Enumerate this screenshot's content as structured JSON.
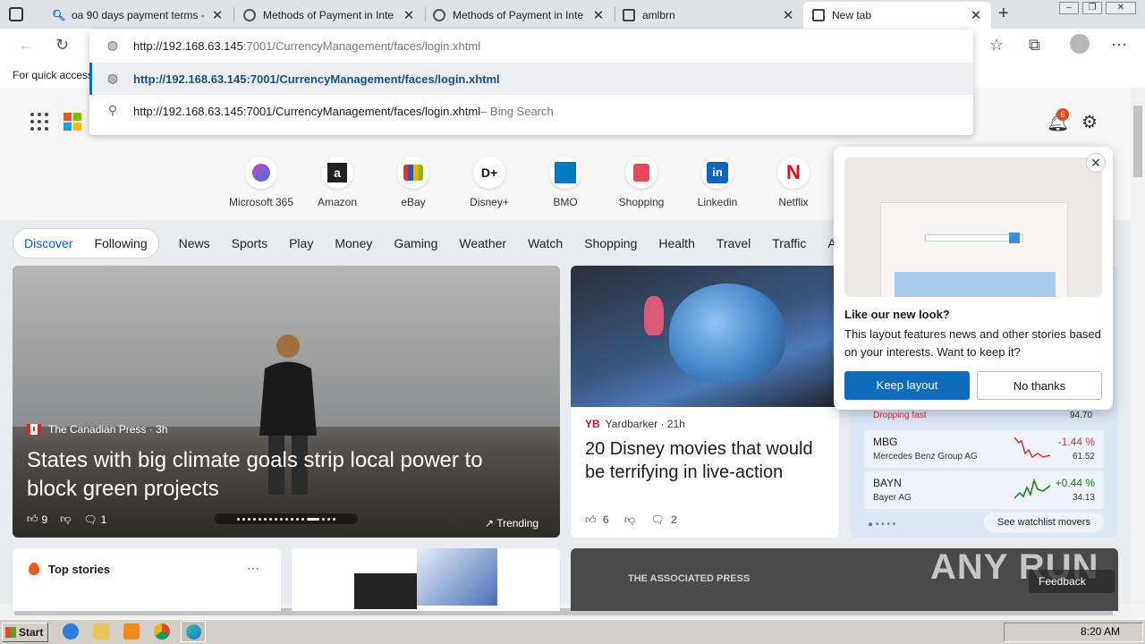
{
  "browser": {
    "tabs": [
      {
        "title": "oa 90 days payment terms -"
      },
      {
        "title": "Methods of Payment in Inte"
      },
      {
        "title": "Methods of Payment in Inte"
      },
      {
        "title": "amlbrn"
      },
      {
        "title": "New tab"
      }
    ],
    "address_bar": {
      "url_host": "http://192.168.63.145",
      "url_rest": ":7001/CurrencyManagement/faces/login.xhtml",
      "suggestion_url": "http://192.168.63.145:7001/CurrencyManagement/faces/login.xhtml",
      "search_text": "http://192.168.63.145:7001/CurrencyManagement/faces/login.xhtml",
      "search_suffix": " – Bing Search"
    },
    "bookmarks_bar_text": "For quick access"
  },
  "header": {
    "notification_count": "6"
  },
  "quick_links": [
    {
      "label": "Microsoft 365",
      "icon": "ms365-icon"
    },
    {
      "label": "Amazon",
      "icon": "amazon-icon"
    },
    {
      "label": "eBay",
      "icon": "ebay-icon"
    },
    {
      "label": "Disney+",
      "icon": "disney-icon"
    },
    {
      "label": "BMO",
      "icon": "bmo-icon"
    },
    {
      "label": "Shopping",
      "icon": "shopping-icon"
    },
    {
      "label": "Linkedin",
      "icon": "linkedin-icon"
    },
    {
      "label": "Netflix",
      "icon": "netflix-icon"
    }
  ],
  "feed_nav": {
    "discover": "Discover",
    "following": "Following",
    "items": [
      "News",
      "Sports",
      "Play",
      "Money",
      "Gaming",
      "Weather",
      "Watch",
      "Shopping",
      "Health",
      "Travel",
      "Traffic",
      "Auto"
    ]
  },
  "hero": {
    "source": "The Canadian Press · 3h",
    "headline": "States with big climate goals strip local power to block green projects",
    "likes": "9",
    "comments": "1",
    "trending": "Trending"
  },
  "card2": {
    "source": "Yardbarker · 21h",
    "source_logo": "YB",
    "headline": "20 Disney movies that would be terrifying in live-action",
    "likes": "6",
    "comments": "2"
  },
  "watchlist": {
    "partial_row": {
      "note": "Dropping fast",
      "price": "94.70"
    },
    "stocks": [
      {
        "symbol": "MBG",
        "name": "Mercedes Benz Group AG",
        "pct": "-1.44 %",
        "price": "61.52",
        "direction": "down"
      },
      {
        "symbol": "BAYN",
        "name": "Bayer AG",
        "pct": "+0.44 %",
        "price": "34.13",
        "direction": "up"
      }
    ],
    "see_movers": "See watchlist movers"
  },
  "popup": {
    "title": "Like our new look?",
    "body": "This layout features news and other stories based on your interests. Want to keep it?",
    "keep": "Keep layout",
    "no": "No thanks"
  },
  "bottom": {
    "top_stories": "Top stories",
    "ap_text": "THE ASSOCIATED PRESS",
    "feedback": "Feedback",
    "watermark": "ANY RUN"
  },
  "taskbar": {
    "start": "Start",
    "clock": "8:20 AM"
  },
  "colors": {
    "accent": "#0f6cbd",
    "negative": "#d13438",
    "positive": "#107c10"
  }
}
